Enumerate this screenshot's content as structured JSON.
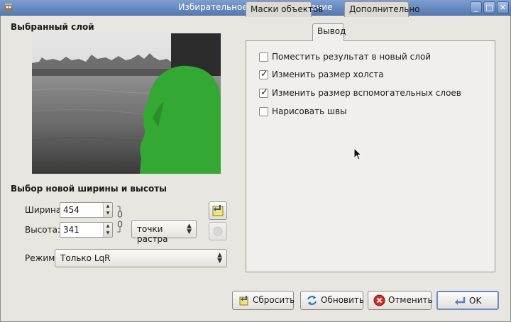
{
  "window": {
    "title": "Избирательное масштабирование"
  },
  "left": {
    "layer_title": "Выбранный слой",
    "size_title": "Выбор новой ширины и высоты",
    "width_label": "Ширина:",
    "width_value": "454",
    "height_label": "Высота:",
    "height_value": "341",
    "units_value": "точки растра",
    "mode_label": "Режим:",
    "mode_value": "Только LqR"
  },
  "tabs": [
    {
      "label": "Маски объектов",
      "active": false
    },
    {
      "label": "Вывод",
      "active": true
    },
    {
      "label": "Дополнительно",
      "active": false
    }
  ],
  "options": [
    {
      "label": "Поместить результат в новый слой",
      "checked": false
    },
    {
      "label": "Изменить размер холста",
      "checked": true
    },
    {
      "label": "Изменить размер вспомогательных слоев",
      "checked": true
    },
    {
      "label": "Нарисовать швы",
      "checked": false
    }
  ],
  "buttons": {
    "reset": "Сбросить",
    "refresh": "Обновить",
    "cancel": "Отменить",
    "ok": "OK"
  },
  "icons": {
    "reset": "reset-icon",
    "refresh": "refresh-icon",
    "cancel": "cancel-icon",
    "ok": "ok-icon",
    "chain": "chain-link-icon"
  }
}
